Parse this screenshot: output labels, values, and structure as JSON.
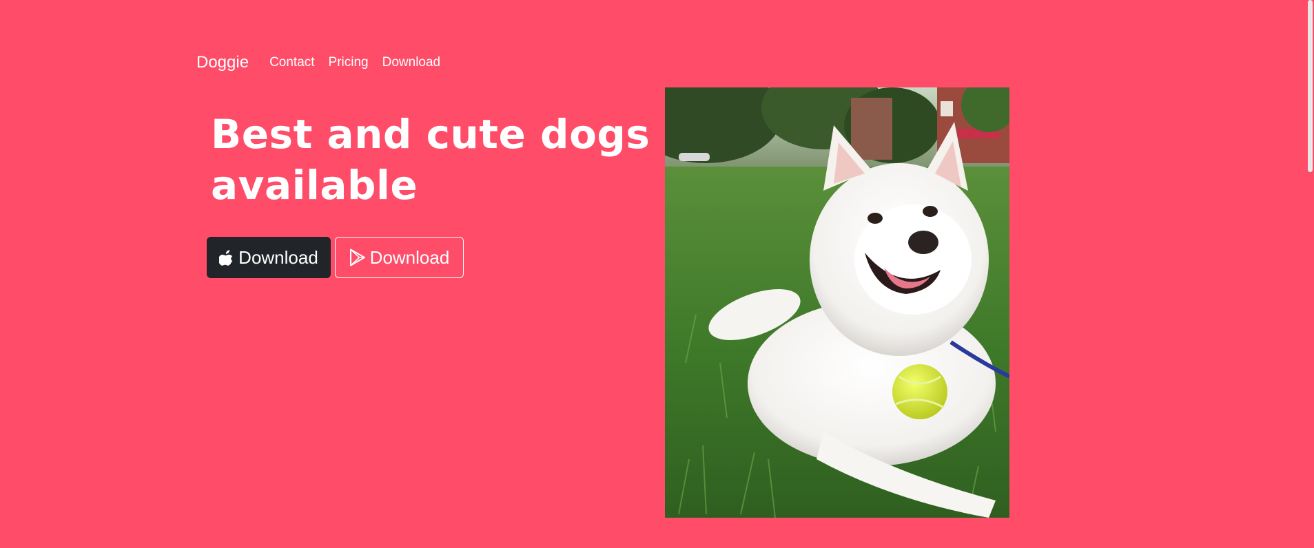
{
  "navbar": {
    "brand": "Doggie",
    "links": [
      "Contact",
      "Pricing",
      "Download"
    ]
  },
  "hero": {
    "title_line1": "Best and cute dogs",
    "title_line2": "available",
    "buttons": [
      {
        "label": "Download",
        "icon": "apple-icon"
      },
      {
        "label": "Download",
        "icon": "google-play-icon"
      }
    ]
  },
  "colors": {
    "background": "#ff4c68",
    "dark_button": "#212529",
    "text": "#ffffff"
  }
}
